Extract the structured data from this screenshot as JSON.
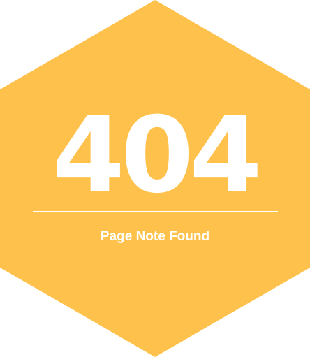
{
  "error": {
    "code": "404",
    "message": "Page Note Found"
  },
  "colors": {
    "hexagon": "#fec24c",
    "text": "#ffffff",
    "background": "#ffffff"
  }
}
